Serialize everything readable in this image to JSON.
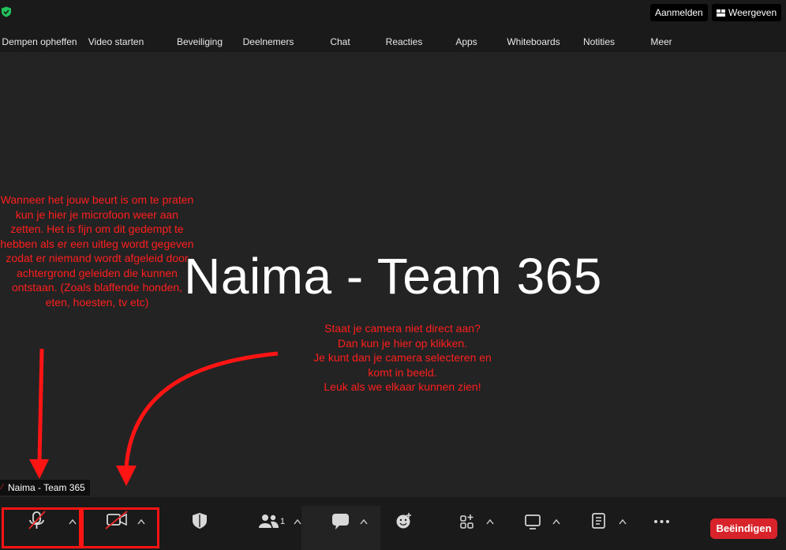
{
  "topbar": {
    "sign_in_label": "Aanmelden",
    "view_label": "Weergeven",
    "security_color": "#21c15b"
  },
  "stage": {
    "participant_display_name": "Naima - Team 365",
    "name_tag": "Naima - Team 365"
  },
  "annotations": {
    "mic_note": "Wanneer het jouw beurt is om te praten kun je hier je microfoon weer aan zetten. Het is fijn om dit gedempt te hebben als er een uitleg wordt gegeven zodat er niemand wordt afgeleid door achtergrond geleiden die kunnen ontstaan. (Zoals blaffende honden, eten, hoesten, tv etc)",
    "camera_note_lines": [
      "Staat je camera niet direct aan?",
      "Dan kun je hier op klikken.",
      "Je kunt dan je camera selecteren en",
      "komt in beeld.",
      "Leuk als we elkaar kunnen zien!"
    ],
    "annotation_color": "#ff1e1e"
  },
  "toolbar": {
    "unmute_label": "Dempen opheffen",
    "start_video_label": "Video starten",
    "security_label": "Beveiliging",
    "participants_label": "Deelnemers",
    "participants_count": "1",
    "chat_label": "Chat",
    "reactions_label": "Reacties",
    "apps_label": "Apps",
    "whiteboards_label": "Whiteboards",
    "notes_label": "Notities",
    "more_label": "Meer",
    "end_label": "Beëindigen",
    "end_color": "#d8232a"
  }
}
